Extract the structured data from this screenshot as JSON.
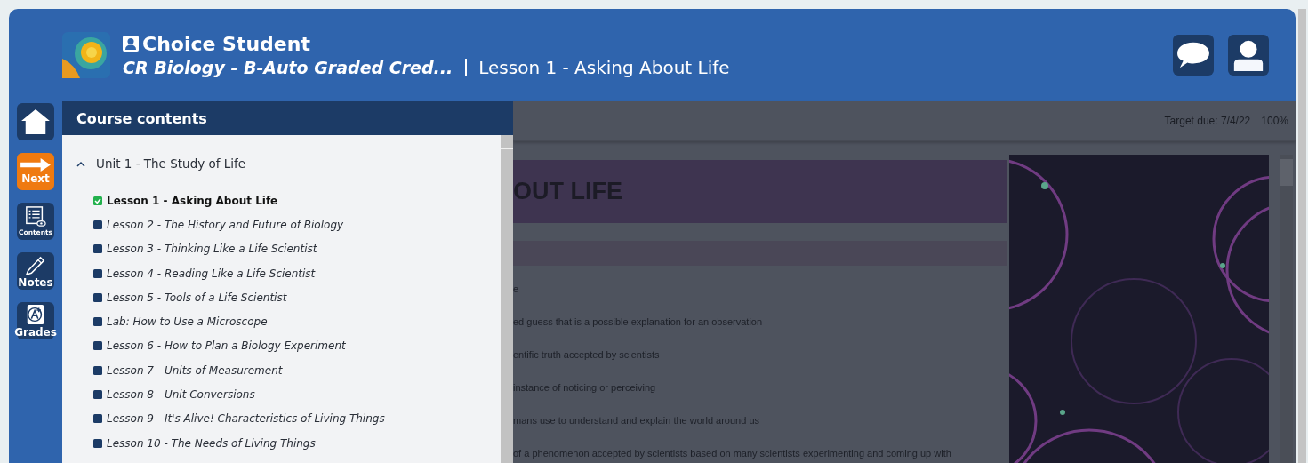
{
  "header": {
    "user_name": "Choice Student",
    "course_title": "CR Biology - B-Auto Graded Cred...",
    "lesson_title": "Lesson 1 - Asking About Life"
  },
  "rail": [
    {
      "kind": "home"
    },
    {
      "kind": "next",
      "label": "Next"
    },
    {
      "kind": "contents",
      "label": "Contents"
    },
    {
      "kind": "notes",
      "label": "Notes"
    },
    {
      "kind": "grades",
      "label": "Grades"
    }
  ],
  "course_contents": {
    "title": "Course contents",
    "unit": {
      "label": "Unit 1 - The Study of Life",
      "expanded": true,
      "lessons": [
        {
          "label": "Lesson 1 - Asking About Life",
          "completed": true,
          "selected": true
        },
        {
          "label": "Lesson 2 - The History and Future of Biology",
          "completed": false,
          "selected": false
        },
        {
          "label": "Lesson 3 - Thinking Like a Life Scientist",
          "completed": false,
          "selected": false
        },
        {
          "label": "Lesson 4 - Reading Like a Life Scientist",
          "completed": false,
          "selected": false
        },
        {
          "label": "Lesson 5 - Tools of a Life Scientist",
          "completed": false,
          "selected": false
        },
        {
          "label": "Lab: How to Use a Microscope",
          "completed": false,
          "selected": false
        },
        {
          "label": "Lesson 6 - How to Plan a Biology Experiment",
          "completed": false,
          "selected": false
        },
        {
          "label": "Lesson 7 - Units of Measurement",
          "completed": false,
          "selected": false
        },
        {
          "label": "Lesson 8 - Unit Conversions",
          "completed": false,
          "selected": false
        },
        {
          "label": "Lesson 9 - It's Alive! Characteristics of Living Things",
          "completed": false,
          "selected": false
        },
        {
          "label": "Lesson 10 - The Needs of Living Things",
          "completed": false,
          "selected": false
        }
      ]
    }
  },
  "lesson": {
    "target_due": "Target due: 7/4/22",
    "zoom": "100%",
    "banner": "OUT LIFE",
    "lines": [
      "e",
      "ed guess that is a possible explanation for an observation",
      "entific truth accepted by scientists",
      "instance of noticing or perceiving",
      "mans use to understand and explain the world around us",
      "of a phenomenon accepted by scientists based on many scientists experimenting and coming up with"
    ]
  }
}
